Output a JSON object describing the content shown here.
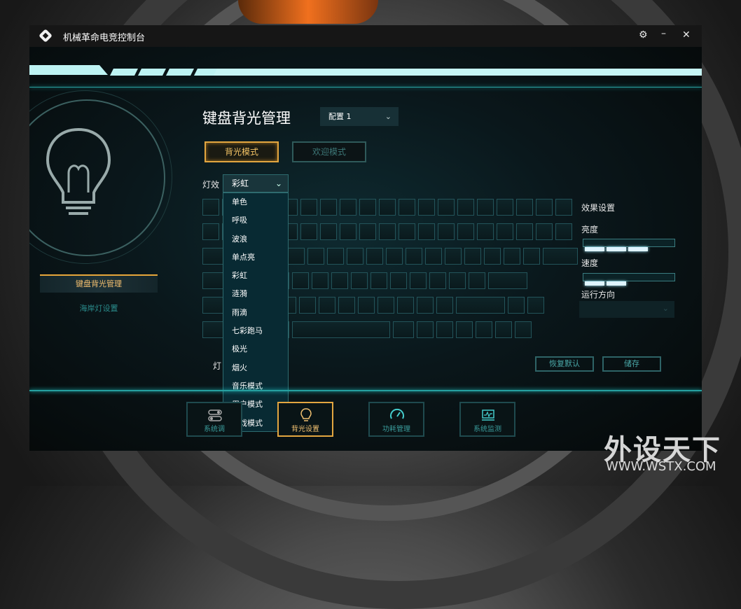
{
  "app": {
    "title": "机械革命电竞控制台"
  },
  "sidebar": {
    "items": [
      {
        "label": "键盘背光管理",
        "active": true
      },
      {
        "label": "海岸灯设置",
        "active": false
      }
    ]
  },
  "main": {
    "heading": "键盘背光管理",
    "profile": {
      "value": "配置 1"
    },
    "modes": [
      "背光模式",
      "欢迎模式"
    ],
    "effect": {
      "label": "灯效",
      "value": "彩虹",
      "options": [
        "单色",
        "呼吸",
        "波浪",
        "单点亮",
        "彩虹",
        "涟漪",
        "雨滴",
        "七彩跑马",
        "极光",
        "烟火",
        "音乐模式",
        "用户模式",
        "游戏模式"
      ]
    },
    "second_label": "灯"
  },
  "settings": {
    "title": "效果设置",
    "brightness_label": "亮度",
    "speed_label": "速度",
    "direction_label": "运行方向",
    "brightness_level": 3,
    "speed_level": 2,
    "max_level": 4
  },
  "actions": {
    "reset": "恢复默认",
    "save": "储存"
  },
  "nav": [
    {
      "label": "系统调",
      "icon": "toggle-icon"
    },
    {
      "label": "背光设置",
      "icon": "bulb-icon"
    },
    {
      "label": "功耗管理",
      "icon": "gauge-icon"
    },
    {
      "label": "系统监测",
      "icon": "monitor-icon"
    }
  ],
  "watermark": {
    "main": "外设天下",
    "sub": "WWW.WSTX.COM"
  },
  "colors": {
    "accent": "#e3a640",
    "teal": "#2aa6a6",
    "dropdown_bg": "#082a33"
  }
}
